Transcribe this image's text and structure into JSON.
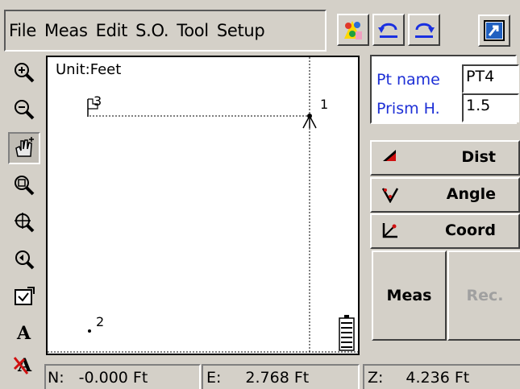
{
  "menu": [
    "File",
    "Meas",
    "Edit",
    "S.O.",
    "Tool",
    "Setup"
  ],
  "toolbar_icons": [
    "color-palette-icon",
    "undo-icon",
    "redo-icon"
  ],
  "exit_icon": "exit-icon",
  "tools": [
    "zoom-in-icon",
    "zoom-out-icon",
    "pan-hand-icon",
    "zoom-window-icon",
    "zoom-extents-icon",
    "zoom-previous-icon",
    "map-select-icon",
    "text-icon",
    "text-off-icon"
  ],
  "canvas": {
    "unit_label": "Unit:Feet",
    "points": [
      {
        "label": "1",
        "symbol": "instrument"
      },
      {
        "label": "2",
        "symbol": "dot"
      },
      {
        "label": "3",
        "symbol": "flag"
      }
    ]
  },
  "panel": {
    "pt_name_label": "Pt name",
    "pt_name_value": "PT4",
    "prism_label": "Prism H.",
    "prism_value": "1.5"
  },
  "modes": [
    {
      "label": "Dist",
      "icon": "distance-icon"
    },
    {
      "label": "Angle",
      "icon": "angle-icon"
    },
    {
      "label": "Coord",
      "icon": "coordinate-icon"
    }
  ],
  "actions": {
    "meas": "Meas",
    "rec": "Rec."
  },
  "status": {
    "n_label": "N:",
    "n_value": "-0.000 Ft",
    "e_label": "E:",
    "e_value": "2.768 Ft",
    "z_label": "Z:",
    "z_value": "4.236 Ft"
  },
  "colors": {
    "label_blue": "#1d2fd6",
    "disabled_text": "#a0a0a0",
    "accent_red": "#d01010"
  }
}
